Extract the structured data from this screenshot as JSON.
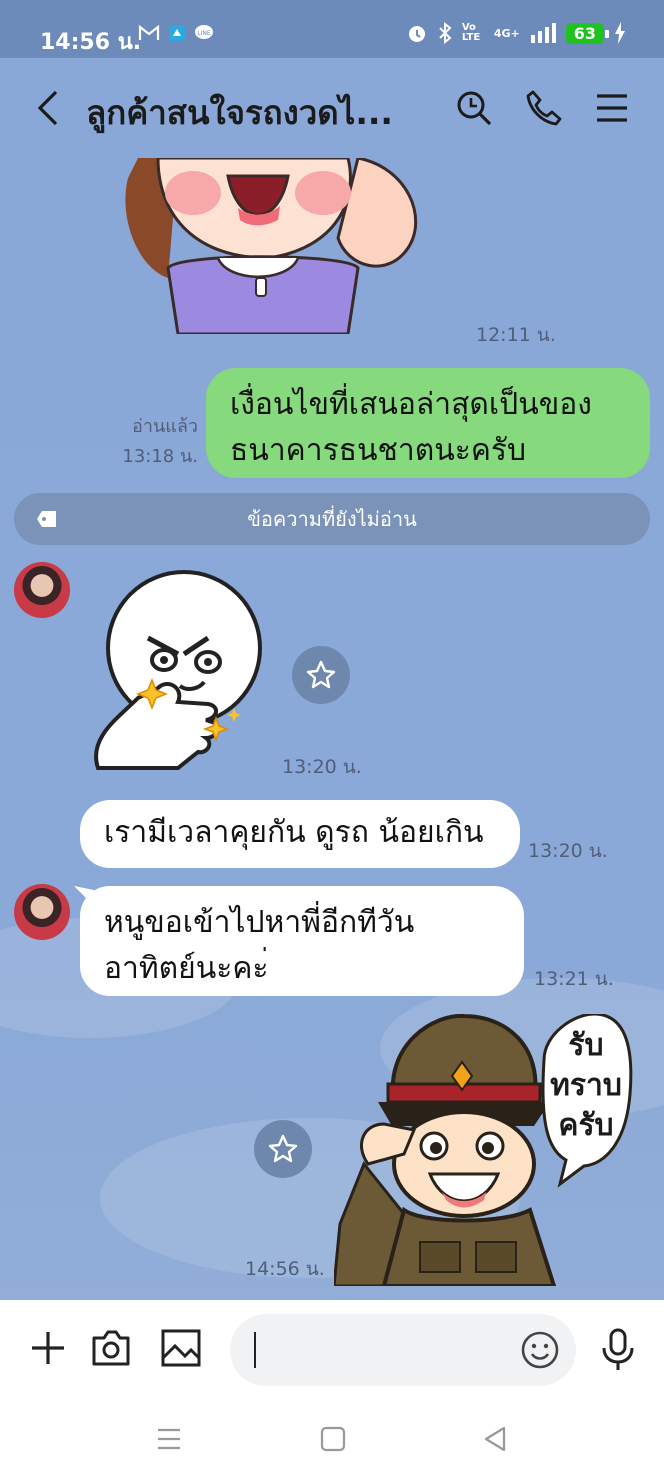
{
  "status_bar": {
    "time": "14:56 น.",
    "battery": "63",
    "network": "4G+",
    "volte": "Vo LTE"
  },
  "header": {
    "title": "ลูกค้าสนใจรถงวดไ..."
  },
  "chat": {
    "sticker1_time": "12:11 น.",
    "msg_out_1": {
      "text": "เงื่อนไขที่เสนอล่าสุดเป็นของธนาคารธนชาตนะครับ",
      "read": "อ่านแล้ว",
      "time": "13:18 น."
    },
    "unread_divider": "ข้อความที่ยังไม่อ่าน",
    "sticker2_time": "13:20 น.",
    "msg_in_1": {
      "text": "เรามีเวลาคุยกัน ดูรถ น้อยเกิน",
      "time": "13:20 น."
    },
    "msg_in_2": {
      "text": "หนูขอเข้าไปหาพี่อีกทีวันอาทิตย์นะคะ่",
      "time": "13:21 น."
    },
    "sticker3_text": "รับ ทราบ ครับ",
    "sticker3_time": "14:56 น."
  },
  "colors": {
    "header_bg": "#8aa8d7",
    "outgoing_bubble": "#86d97d",
    "incoming_bubble": "#ffffff",
    "statusbar_bg": "#6c8aba"
  },
  "icons": [
    "back-icon",
    "search-icon",
    "phone-icon",
    "menu-icon",
    "plus-icon",
    "camera-icon",
    "image-icon",
    "emoji-icon",
    "mic-icon",
    "star-icon"
  ]
}
